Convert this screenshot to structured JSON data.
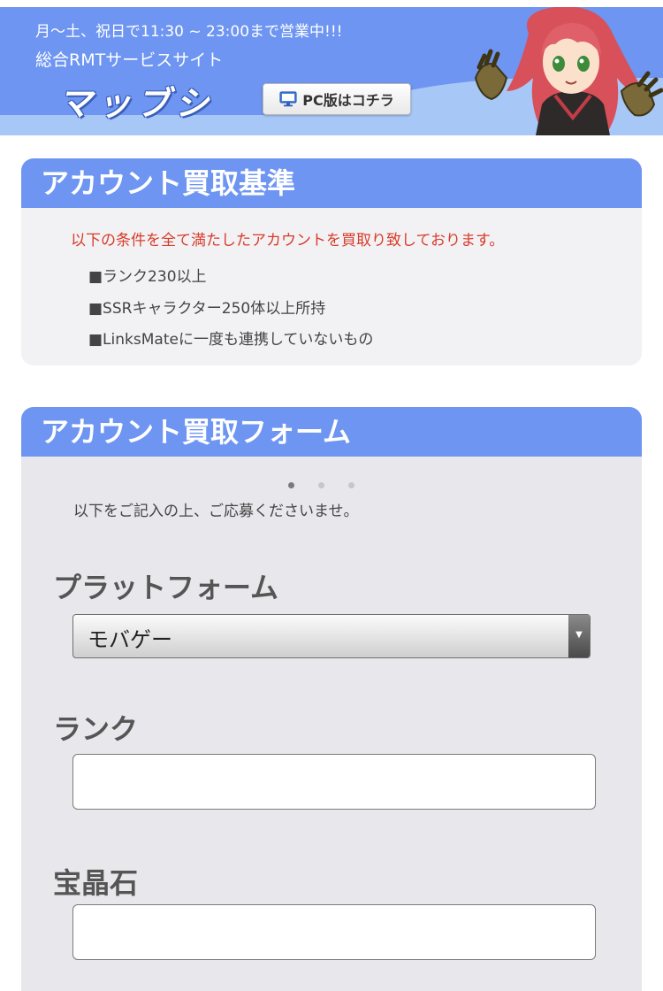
{
  "header": {
    "hours": "月〜土、祝日で11:30 ~ 23:00まで営業中!!!",
    "subtitle": "総合RMTサービスサイト",
    "logo": "マッブシ",
    "pc_button_label": "PC版はコチラ",
    "pc_button_icon": "monitor-icon",
    "mascot": "mascot-character-illustration"
  },
  "criteria": {
    "title": "アカウント買取基準",
    "lead": "以下の条件を全て満たしたアカウントを買取り致しております。",
    "items": [
      "■ランク230以上",
      "■SSRキャラクター250体以上所持",
      "■LinksMateに一度も連携していないもの"
    ]
  },
  "form": {
    "title": "アカウント買取フォーム",
    "step_dots": 3,
    "active_step": 1,
    "intro": "以下をご記入の上、ご応募くださいませ。",
    "fields": {
      "platform": {
        "label": "プラットフォーム",
        "selected": "モバゲー"
      },
      "rank": {
        "label": "ランク",
        "value": ""
      },
      "crystal": {
        "label": "宝晶石",
        "value": ""
      }
    }
  },
  "colors": {
    "accent": "#6d95f1",
    "header_light": "#a7c7f7",
    "warning": "#d93b2a",
    "panel_bg": "#f2f2f4"
  }
}
